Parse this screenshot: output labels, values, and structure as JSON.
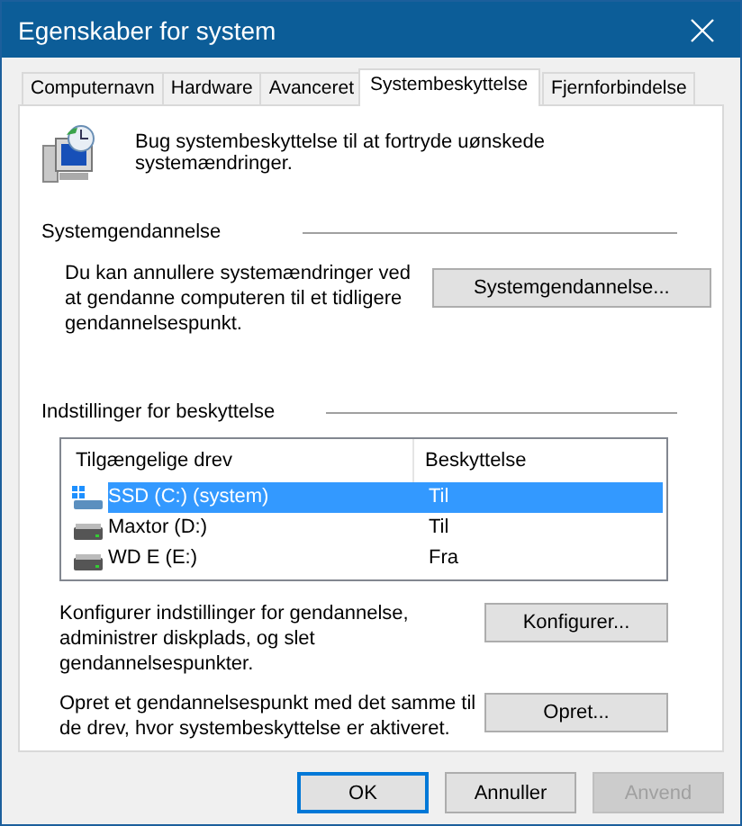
{
  "window": {
    "title": "Egenskaber for system"
  },
  "tabs": [
    {
      "label": "Computernavn",
      "selected": false
    },
    {
      "label": "Hardware",
      "selected": false
    },
    {
      "label": "Avanceret",
      "selected": false
    },
    {
      "label": "Systembeskyttelse",
      "selected": true
    },
    {
      "label": "Fjernforbindelse",
      "selected": false
    }
  ],
  "intro": "Bug systembeskyttelse til at fortryde uønskede systemændringer.",
  "restore_group": {
    "title": "Systemgendannelse",
    "text": "Du kan annullere systemændringer ved at gendanne computeren til et tidligere gendannelsespunkt.",
    "button": "Systemgendannelse..."
  },
  "protection_group": {
    "title": "Indstillinger for beskyttelse",
    "table": {
      "columns": [
        "Tilgængelige drev",
        "Beskyttelse"
      ],
      "rows": [
        {
          "drive": "SSD (C:) (system)",
          "protection": "Til",
          "kind": "system",
          "selected": true
        },
        {
          "drive": "Maxtor (D:)",
          "protection": "Til",
          "kind": "disk",
          "selected": false
        },
        {
          "drive": "WD E (E:)",
          "protection": "Fra",
          "kind": "disk",
          "selected": false
        }
      ]
    },
    "actions": [
      {
        "text": "Konfigurer indstillinger for gendannelse, administrer diskplads, og slet gendannelsespunkter.",
        "button": "Konfigurer..."
      },
      {
        "text": "Opret et gendannelsespunkt med det samme til de drev, hvor systembeskyttelse er aktiveret.",
        "button": "Opret..."
      }
    ]
  },
  "buttons": [
    {
      "label": "OK",
      "default": true,
      "disabled": false
    },
    {
      "label": "Annuller",
      "default": false,
      "disabled": false
    },
    {
      "label": "Anvend",
      "default": false,
      "disabled": true
    }
  ]
}
